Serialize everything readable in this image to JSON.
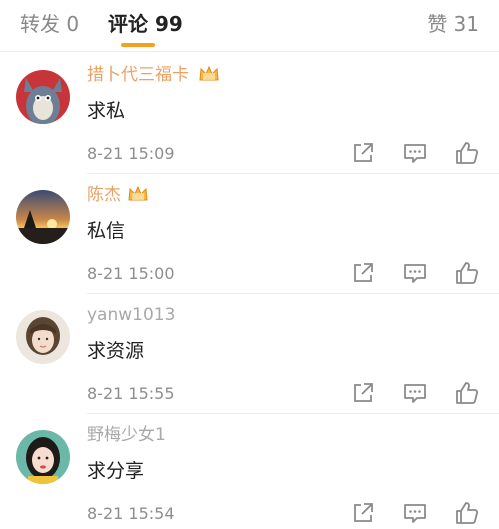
{
  "tabs": {
    "repost": "转发 0",
    "comments": "评论 99",
    "likes": "赞 31"
  },
  "colors": {
    "accent": "#f8a01e",
    "username": "#e8914a",
    "secondary_text": "#8e8e8e"
  },
  "comments": [
    {
      "username": "措卜代三福卡",
      "text": "求私",
      "time": "8-21 15:09"
    },
    {
      "username": "陈杰",
      "text": "私信",
      "time": "8-21 15:00"
    },
    {
      "username": "yanw1013",
      "text": "求资源",
      "time": "8-21 15:55"
    },
    {
      "username": "野梅少女1",
      "text": "求分享",
      "time": "8-21 15:54"
    }
  ],
  "icons": [
    "share-icon",
    "reply-icon",
    "like-icon",
    "vip-crown-icon"
  ]
}
